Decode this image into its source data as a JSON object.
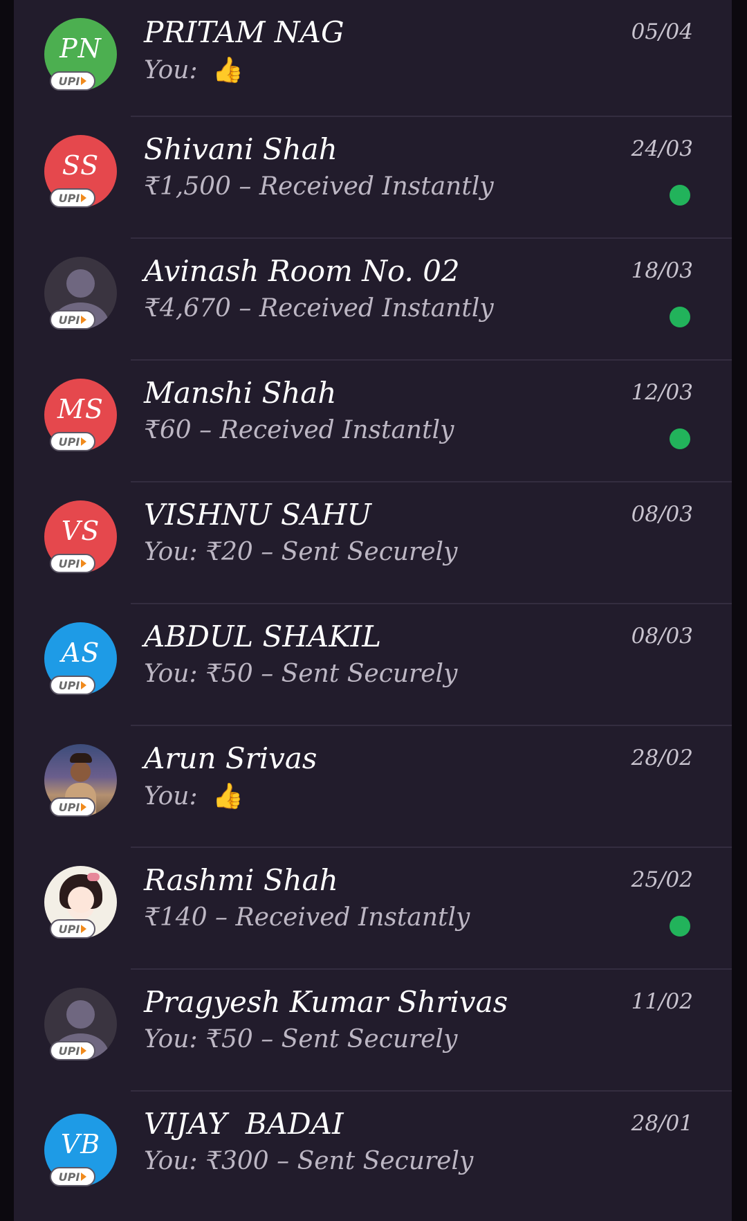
{
  "conversations": [
    {
      "name": "PRITAM NAG",
      "initials": "PN",
      "avatar_color": "#4caf50",
      "date": "05/04",
      "subtitle": "You: ",
      "emoji": "👍",
      "unread": false,
      "badge": "UPI"
    },
    {
      "name": "Shivani Shah",
      "initials": "SS",
      "avatar_color": "#e5484d",
      "date": "24/03",
      "subtitle": "₹1,500 – Received Instantly",
      "emoji": "",
      "unread": true,
      "badge": "UPI"
    },
    {
      "name": "Avinash Room No. 02",
      "initials": "",
      "avatar_color": "#3a3440",
      "date": "18/03",
      "subtitle": "₹4,670 – Received Instantly",
      "emoji": "",
      "unread": true,
      "badge": "UPI"
    },
    {
      "name": "Manshi Shah",
      "initials": "MS",
      "avatar_color": "#e5484d",
      "date": "12/03",
      "subtitle": "₹60 – Received Instantly",
      "emoji": "",
      "unread": true,
      "badge": "UPI"
    },
    {
      "name": "VISHNU SAHU",
      "initials": "VS",
      "avatar_color": "#e5484d",
      "date": "08/03",
      "subtitle": "You: ₹20 – Sent Securely",
      "emoji": "",
      "unread": false,
      "badge": "UPI"
    },
    {
      "name": "ABDUL SHAKIL",
      "initials": "AS",
      "avatar_color": "#1e9be6",
      "date": "08/03",
      "subtitle": "You: ₹50 – Sent Securely",
      "emoji": "",
      "unread": false,
      "badge": "UPI"
    },
    {
      "name": "Arun Srivas",
      "initials": "",
      "avatar_color": "#5a5080",
      "date": "28/02",
      "subtitle": "You: ",
      "emoji": "👍",
      "unread": false,
      "badge": "UPI"
    },
    {
      "name": "Rashmi Shah",
      "initials": "",
      "avatar_color": "#f3efe6",
      "date": "25/02",
      "subtitle": "₹140 – Received Instantly",
      "emoji": "",
      "unread": true,
      "badge": "UPI"
    },
    {
      "name": "Pragyesh Kumar Shrivas",
      "initials": "",
      "avatar_color": "#3a3440",
      "date": "11/02",
      "subtitle": "You: ₹50 – Sent Securely",
      "emoji": "",
      "unread": false,
      "badge": "UPI"
    },
    {
      "name": "VIJAY  BADAI",
      "initials": "VB",
      "avatar_color": "#1e9be6",
      "date": "28/01",
      "subtitle": "You: ₹300 – Sent Securely",
      "emoji": "",
      "unread": false,
      "badge": "UPI"
    }
  ],
  "colors": {
    "background": "#221c2c",
    "unread_dot": "#22b35b",
    "divider": "#342d40"
  },
  "icons": {
    "reaction": "thumbs-up-icon",
    "default_avatar": "person-icon",
    "badge": "upi-logo-icon"
  }
}
